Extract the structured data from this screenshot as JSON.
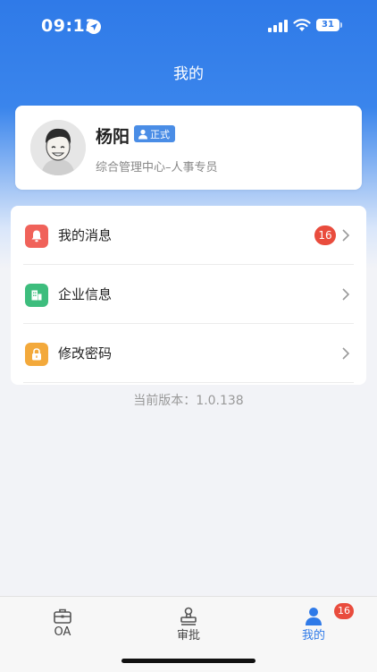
{
  "status_bar": {
    "time": "09:13",
    "battery": "31"
  },
  "header": {
    "title": "我的"
  },
  "profile": {
    "name": "杨阳",
    "badge": "正式",
    "department": "综合管理中心–人事专员"
  },
  "menu": [
    {
      "label": "我的消息",
      "icon": "bell-icon",
      "icon_color": "#f0625a",
      "badge": "16"
    },
    {
      "label": "企业信息",
      "icon": "building-icon",
      "icon_color": "#3dbd7d"
    },
    {
      "label": "修改密码",
      "icon": "lock-icon",
      "icon_color": "#f3a93b"
    }
  ],
  "version_text": "当前版本：1.0.138",
  "tabs": [
    {
      "label": "OA",
      "icon": "briefcase-icon"
    },
    {
      "label": "审批",
      "icon": "stamp-icon"
    },
    {
      "label": "我的",
      "icon": "person-icon",
      "active": true,
      "badge": "16"
    }
  ],
  "colors": {
    "accent": "#2f7ae8",
    "badge_red": "#e94c3d"
  }
}
